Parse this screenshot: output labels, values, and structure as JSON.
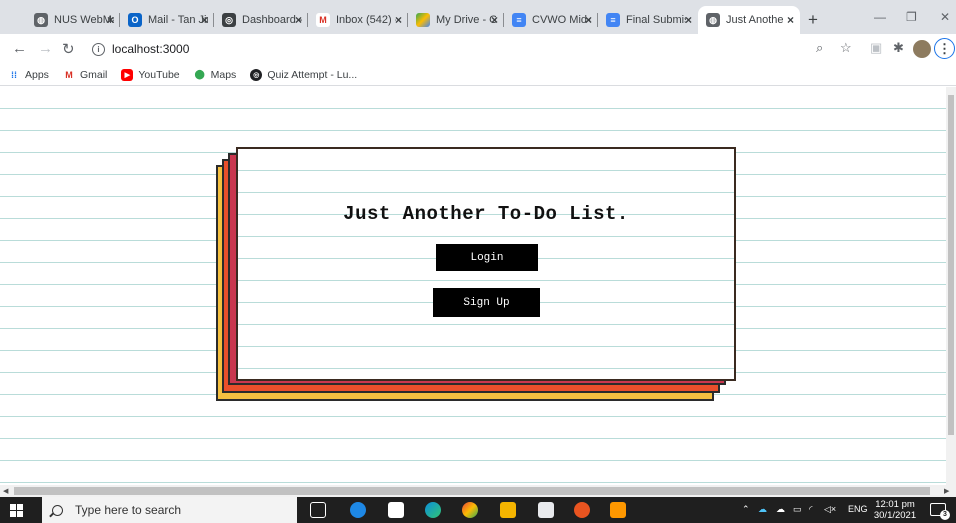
{
  "browser": {
    "tabs": [
      {
        "title": "NUS WebMail",
        "icon": "globe-icon",
        "color": "#5f6368"
      },
      {
        "title": "Mail - Tan Jin",
        "icon": "outlook-icon",
        "color": "#0a64c8"
      },
      {
        "title": "Dashboard - ",
        "icon": "dashboard-icon",
        "color": "#3c4043"
      },
      {
        "title": "Inbox (542) - ",
        "icon": "gmail-icon",
        "color": "#d93025"
      },
      {
        "title": "My Drive - G",
        "icon": "drive-icon",
        "color": "#fbbc04"
      },
      {
        "title": "CVWO Mid-",
        "icon": "docs-icon",
        "color": "#4285f4"
      },
      {
        "title": "Final Submis",
        "icon": "docs-icon",
        "color": "#4285f4"
      },
      {
        "title": "Just Anothe",
        "icon": "globe-icon",
        "color": "#5f6368",
        "active": true
      }
    ],
    "new_tab": "+",
    "address": "localhost:3000",
    "window_controls": {
      "minimize": "—",
      "restore": "❐",
      "close": "✕"
    }
  },
  "bookmarks": [
    {
      "label": "Apps",
      "icon": "apps-grid-icon",
      "color": "#1a73e8"
    },
    {
      "label": "Gmail",
      "icon": "gmail-icon",
      "color": "#d93025"
    },
    {
      "label": "YouTube",
      "icon": "youtube-icon",
      "color": "#ff0000"
    },
    {
      "label": "Maps",
      "icon": "maps-pin-icon",
      "color": "#34a853"
    },
    {
      "label": "Quiz Attempt - Lu...",
      "icon": "quiz-icon",
      "color": "#202124"
    }
  ],
  "page": {
    "title": "Just Another To-Do List.",
    "login_label": "Login",
    "signup_label": "Sign Up",
    "colors": {
      "yellow": "#f5c040",
      "orange": "#e94f2b",
      "red": "#c9374f",
      "line": "#b9dcd9"
    }
  },
  "taskbar": {
    "search_placeholder": "Type here to search",
    "language": "ENG",
    "time": "12:01 pm",
    "date": "30/1/2021",
    "notifications": "3"
  }
}
